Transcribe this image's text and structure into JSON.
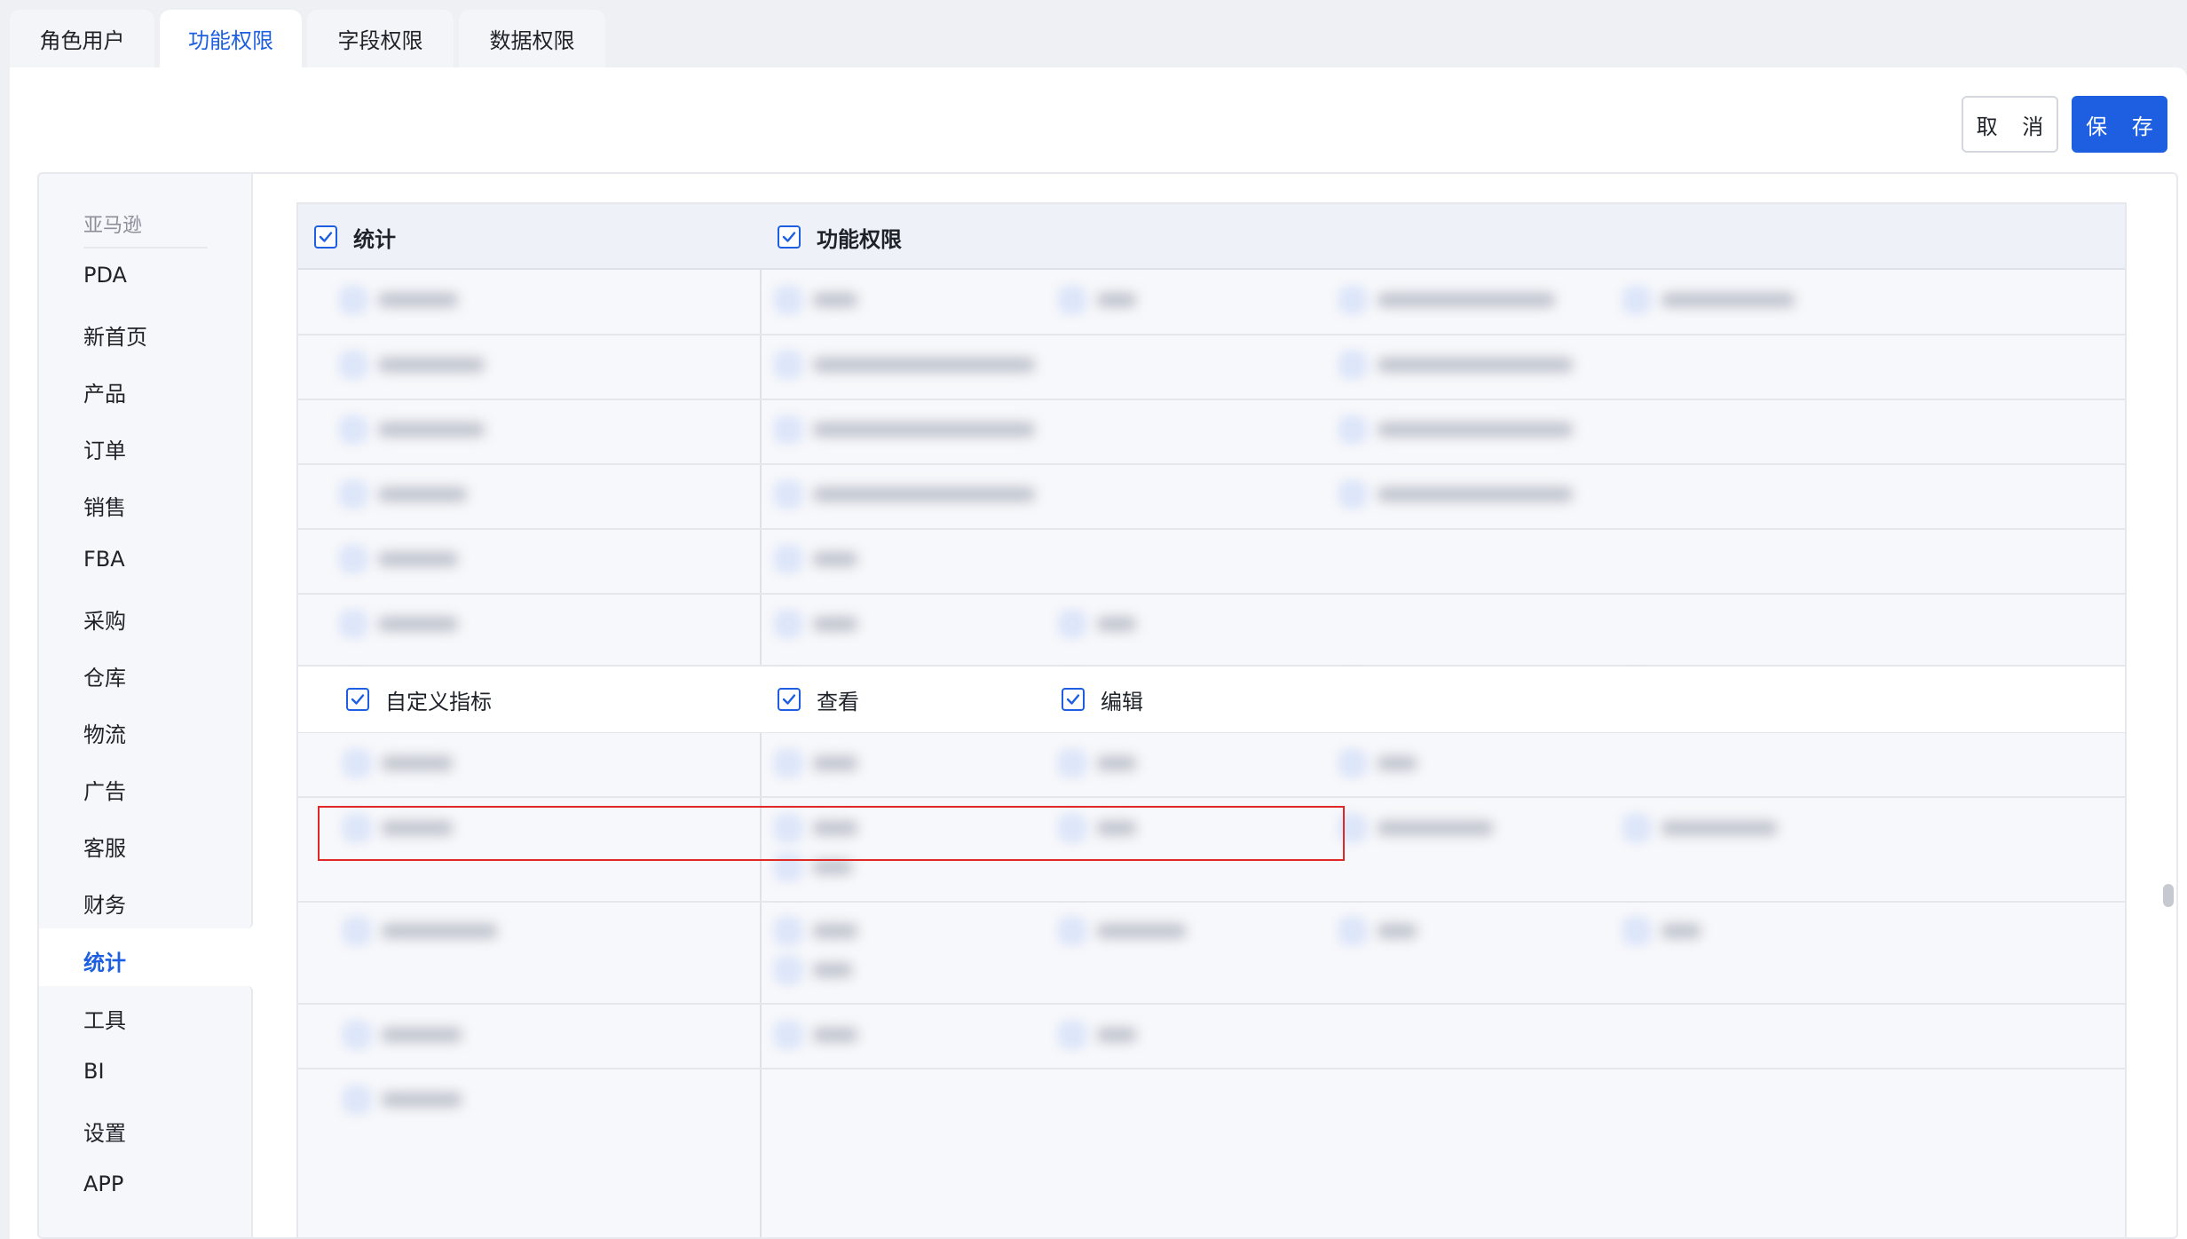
{
  "tabs": [
    {
      "label": "角色用户",
      "active": false
    },
    {
      "label": "功能权限",
      "active": true
    },
    {
      "label": "字段权限",
      "active": false
    },
    {
      "label": "数据权限",
      "active": false
    }
  ],
  "actions": {
    "cancel": "取 消",
    "save": "保 存"
  },
  "sidebar": {
    "group": "亚马逊",
    "items": [
      "PDA",
      "新首页",
      "产品",
      "订单",
      "销售",
      "FBA",
      "采购",
      "仓库",
      "物流",
      "广告",
      "客服",
      "财务",
      "统计",
      "工具",
      "BI",
      "设置",
      "APP"
    ],
    "active": "统计"
  },
  "table": {
    "header": {
      "module": "统计",
      "permissions": "功能权限",
      "module_checked": true,
      "permissions_checked": true
    },
    "highlighted_row": {
      "module": "自定义指标",
      "permissions": [
        "查看",
        "编辑"
      ],
      "all_checked": true
    }
  },
  "colors": {
    "accent": "#1d5fe0",
    "highlight_border": "#e02828"
  }
}
